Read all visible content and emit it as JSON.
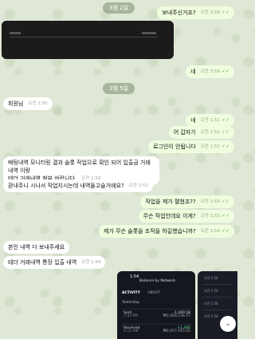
{
  "dates": [
    "3월 2일",
    "3월 5일"
  ],
  "messages": [
    {
      "text": "보내주신거죠?",
      "time": "오전 3:58",
      "dir": "out",
      "read": true
    },
    {
      "text": "네",
      "time": "오전 3:59",
      "dir": "out",
      "read": true
    },
    {
      "text": "회원님",
      "time": "오전 1:50",
      "dir": "in"
    },
    {
      "text": "네",
      "time": "오전 1:51",
      "dir": "out",
      "read": true
    },
    {
      "text": "어 갑자기",
      "time": "오전 1:52",
      "dir": "out",
      "read": true
    },
    {
      "text": "로그인이 안됩니다",
      "time": "오전 1:52",
      "dir": "out",
      "read": true
    },
    {
      "text": "배팅내역 모니터링 결과 슬롯 작업으로 확인 되어 입출금 거래내역 이랑",
      "text2": "테더 거래내역 첨부 바랍니다.",
      "time": "오전 1:53",
      "dir": "in"
    },
    {
      "text": "환내주니 시나서 작업지시는데 내역들고슬거에요?",
      "time": "오전 1:53",
      "dir": "in"
    },
    {
      "text": "작업을 제가 펼쳤죠??",
      "time": "오전 1:53",
      "dir": "out",
      "read": true
    },
    {
      "text": "무슨 작업인데요 이게?",
      "time": "오전 1:53",
      "dir": "out",
      "read": true
    },
    {
      "text": "제가 무슨 슬롯을 조작을 하길했습니까?",
      "time": "오전 1:54",
      "dir": "out",
      "read": true
    },
    {
      "text": "본인 내역 다 보내주세요",
      "time": "",
      "dir": "in"
    },
    {
      "text": "테더 거래내역 통장 입출 내역",
      "time": "오전 1:54",
      "dir": "in"
    }
  ],
  "checkmark": "✓✓",
  "phone": {
    "time": "1:54",
    "header": "Balance by Network",
    "tabs": [
      "ACTIVITY",
      "ABOUT"
    ],
    "section": "Yesterday",
    "rows": [
      {
        "label": "Sent",
        "sub": "7:43 PM",
        "amount": "-1,449.58",
        "krw": "₩2,000,136.57"
      },
      {
        "label": "Received",
        "sub": "4:12 AM",
        "amount": "+1,486",
        "krw": "₩2,057,915.05"
      }
    ]
  },
  "side_times": [
    "오전 1:54",
    "오전 1:54",
    "오전 1:54",
    "오전 1:54"
  ],
  "icons": {
    "scroll_down": "chevron-down-icon"
  }
}
